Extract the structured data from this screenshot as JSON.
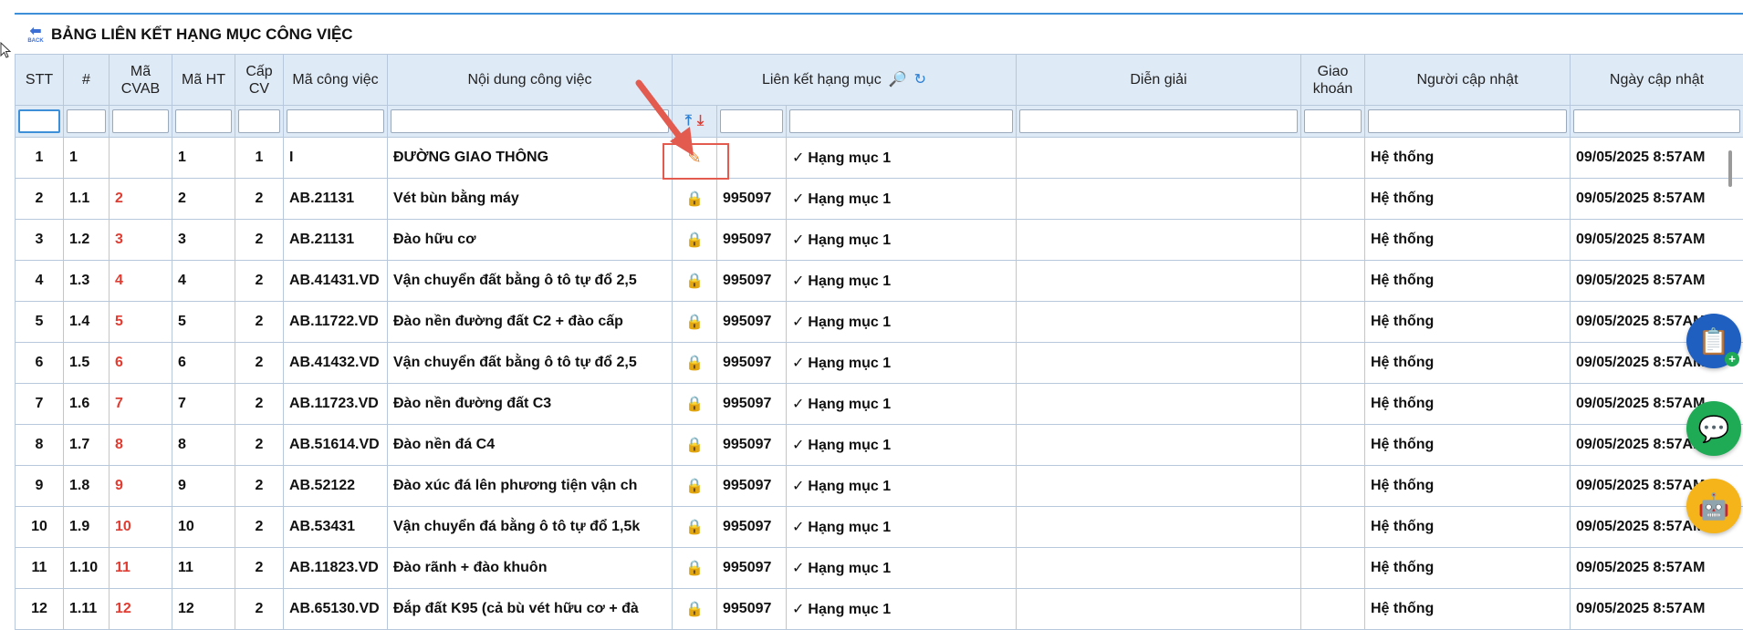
{
  "header": {
    "back_label": "BACK",
    "title": "BẢNG LIÊN KẾT HẠNG MỤC CÔNG VIỆC"
  },
  "columns": {
    "stt": "STT",
    "hash": "#",
    "ma_cvab": "Mã CVAB",
    "ma_ht": "Mã HT",
    "cap_cv": "Cấp CV",
    "ma_cong_viec": "Mã công việc",
    "noi_dung": "Nội dung công việc",
    "lien_ket": "Liên kết hạng mục",
    "dien_giai": "Diễn giải",
    "giao_khoan": "Giao khoán",
    "nguoi_cap_nhat": "Người cập nhật",
    "ngay_cap_nhat": "Ngày cập nhật"
  },
  "rows": [
    {
      "stt": "1",
      "hash": "1",
      "ma_cvab": "",
      "ma_ht": "1",
      "cap_cv": "1",
      "ma_cv": "I",
      "noi_dung": "ĐƯỜNG GIAO THÔNG",
      "action": "pencil",
      "code": "",
      "hang_muc": "Hạng mục 1",
      "dien_giai": "",
      "giao_khoan": "",
      "nguoi": "Hệ thống",
      "ngay": "09/05/2025 8:57AM"
    },
    {
      "stt": "2",
      "hash": "1.1",
      "ma_cvab": "2",
      "ma_ht": "2",
      "cap_cv": "2",
      "ma_cv": "AB.21131",
      "noi_dung": "Vét bùn bằng máy",
      "action": "lock",
      "code": "995097",
      "hang_muc": "Hạng mục 1",
      "dien_giai": "",
      "giao_khoan": "",
      "nguoi": "Hệ thống",
      "ngay": "09/05/2025 8:57AM"
    },
    {
      "stt": "3",
      "hash": "1.2",
      "ma_cvab": "3",
      "ma_ht": "3",
      "cap_cv": "2",
      "ma_cv": "AB.21131",
      "noi_dung": "Đào hữu cơ",
      "action": "lock",
      "code": "995097",
      "hang_muc": "Hạng mục 1",
      "dien_giai": "",
      "giao_khoan": "",
      "nguoi": "Hệ thống",
      "ngay": "09/05/2025 8:57AM"
    },
    {
      "stt": "4",
      "hash": "1.3",
      "ma_cvab": "4",
      "ma_ht": "4",
      "cap_cv": "2",
      "ma_cv": "AB.41431.VD",
      "noi_dung": "Vận chuyển đất bằng ô tô tự đổ 2,5",
      "action": "lock",
      "code": "995097",
      "hang_muc": "Hạng mục 1",
      "dien_giai": "",
      "giao_khoan": "",
      "nguoi": "Hệ thống",
      "ngay": "09/05/2025 8:57AM"
    },
    {
      "stt": "5",
      "hash": "1.4",
      "ma_cvab": "5",
      "ma_ht": "5",
      "cap_cv": "2",
      "ma_cv": "AB.11722.VD",
      "noi_dung": "Đào nền đường đất C2 + đào cấp",
      "action": "lock",
      "code": "995097",
      "hang_muc": "Hạng mục 1",
      "dien_giai": "",
      "giao_khoan": "",
      "nguoi": "Hệ thống",
      "ngay": "09/05/2025 8:57AM"
    },
    {
      "stt": "6",
      "hash": "1.5",
      "ma_cvab": "6",
      "ma_ht": "6",
      "cap_cv": "2",
      "ma_cv": "AB.41432.VD",
      "noi_dung": "Vận chuyển đất bằng ô tô tự đổ 2,5",
      "action": "lock",
      "code": "995097",
      "hang_muc": "Hạng mục 1",
      "dien_giai": "",
      "giao_khoan": "",
      "nguoi": "Hệ thống",
      "ngay": "09/05/2025 8:57AM"
    },
    {
      "stt": "7",
      "hash": "1.6",
      "ma_cvab": "7",
      "ma_ht": "7",
      "cap_cv": "2",
      "ma_cv": "AB.11723.VD",
      "noi_dung": "Đào nền đường đất C3",
      "action": "lock",
      "code": "995097",
      "hang_muc": "Hạng mục 1",
      "dien_giai": "",
      "giao_khoan": "",
      "nguoi": "Hệ thống",
      "ngay": "09/05/2025 8:57AM"
    },
    {
      "stt": "8",
      "hash": "1.7",
      "ma_cvab": "8",
      "ma_ht": "8",
      "cap_cv": "2",
      "ma_cv": "AB.51614.VD",
      "noi_dung": "Đào nền đá C4",
      "action": "lock",
      "code": "995097",
      "hang_muc": "Hạng mục 1",
      "dien_giai": "",
      "giao_khoan": "",
      "nguoi": "Hệ thống",
      "ngay": "09/05/2025 8:57AM"
    },
    {
      "stt": "9",
      "hash": "1.8",
      "ma_cvab": "9",
      "ma_ht": "9",
      "cap_cv": "2",
      "ma_cv": "AB.52122",
      "noi_dung": "Đào xúc đá lên phương tiện vận ch",
      "action": "lock",
      "code": "995097",
      "hang_muc": "Hạng mục 1",
      "dien_giai": "",
      "giao_khoan": "",
      "nguoi": "Hệ thống",
      "ngay": "09/05/2025 8:57AM"
    },
    {
      "stt": "10",
      "hash": "1.9",
      "ma_cvab": "10",
      "ma_ht": "10",
      "cap_cv": "2",
      "ma_cv": "AB.53431",
      "noi_dung": "Vận chuyển đá bằng ô tô tự đổ 1,5k",
      "action": "lock",
      "code": "995097",
      "hang_muc": "Hạng mục 1",
      "dien_giai": "",
      "giao_khoan": "",
      "nguoi": "Hệ thống",
      "ngay": "09/05/2025 8:57AM"
    },
    {
      "stt": "11",
      "hash": "1.10",
      "ma_cvab": "11",
      "ma_ht": "11",
      "cap_cv": "2",
      "ma_cv": "AB.11823.VD",
      "noi_dung": "Đào rãnh + đào khuôn",
      "action": "lock",
      "code": "995097",
      "hang_muc": "Hạng mục 1",
      "dien_giai": "",
      "giao_khoan": "",
      "nguoi": "Hệ thống",
      "ngay": "09/05/2025 8:57AM"
    },
    {
      "stt": "12",
      "hash": "1.11",
      "ma_cvab": "12",
      "ma_ht": "12",
      "cap_cv": "2",
      "ma_cv": "AB.65130.VD",
      "noi_dung": "Đắp đất K95 (cả bù vét hữu cơ + đà",
      "action": "lock",
      "code": "995097",
      "hang_muc": "Hạng mục 1",
      "dien_giai": "",
      "giao_khoan": "",
      "nguoi": "Hệ thống",
      "ngay": "09/05/2025 8:57AM"
    }
  ],
  "icons": {
    "back": "back-arrow-icon",
    "search": "search-icon",
    "refresh": "refresh-icon",
    "upload": "upload-icon",
    "download": "download-icon",
    "lock": "lock-icon",
    "pencil": "pencil-icon",
    "checkmark": "✓"
  },
  "colors": {
    "header_bg": "#dfeaf7",
    "accent": "#3d8fd8",
    "red_text": "#e03c31",
    "highlight": "#e35a4f"
  }
}
